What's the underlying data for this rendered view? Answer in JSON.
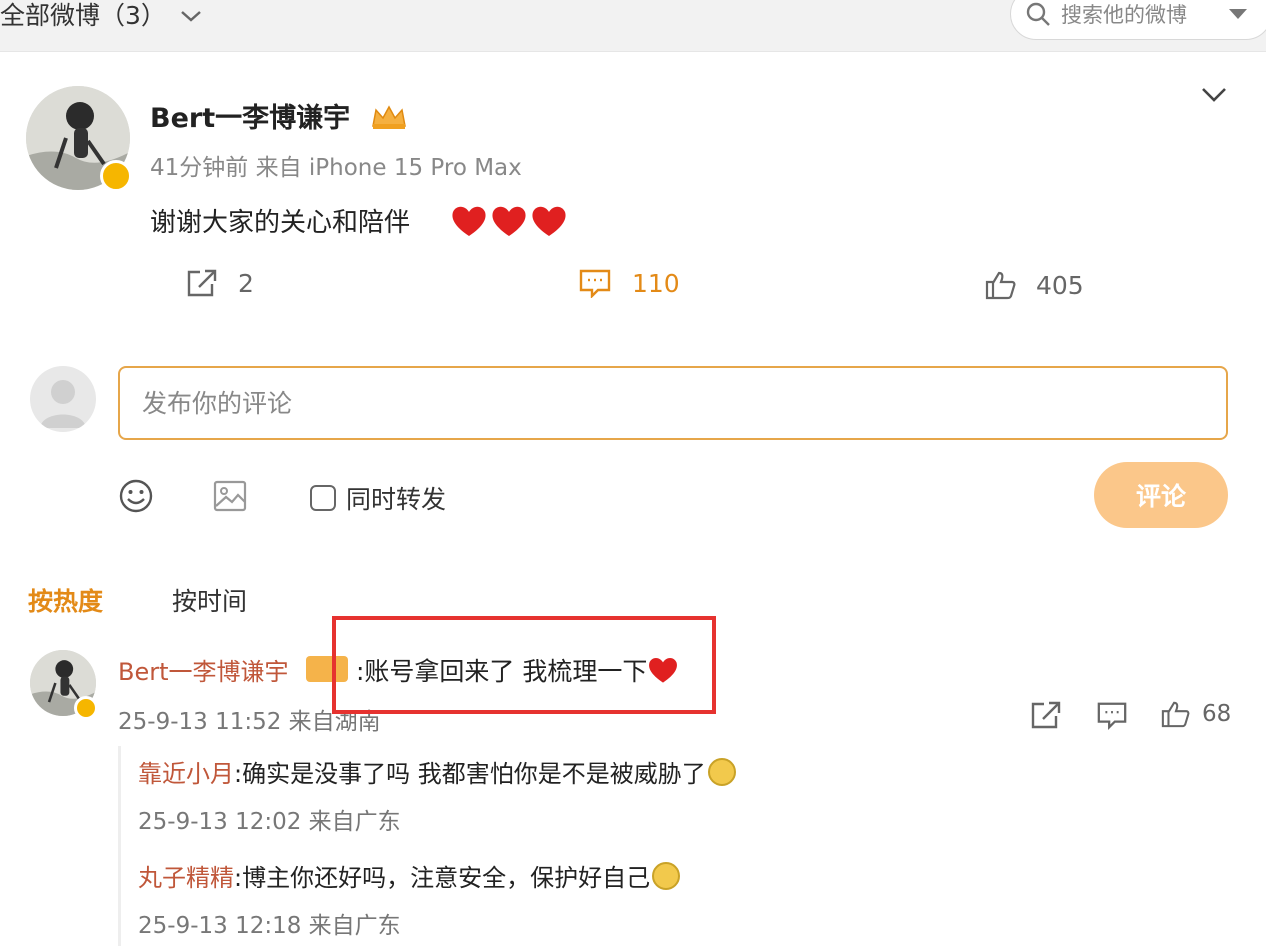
{
  "topbar": {
    "filter_label": "全部微博（3）",
    "search_placeholder": "搜索他的微博"
  },
  "post": {
    "author": "Bert一李博谦宇",
    "meta": "41分钟前 来自 iPhone 15 Pro Max",
    "text": "谢谢大家的关心和陪伴",
    "repost_count": "2",
    "comment_count": "110",
    "like_count": "405"
  },
  "composer": {
    "placeholder": "发布你的评论",
    "repost_label": "同时转发",
    "submit_label": "评论"
  },
  "sort": {
    "hot_label": "按热度",
    "time_label": "按时间"
  },
  "comment": {
    "author": "Bert一李博谦宇",
    "text": ":账号拿回来了 我梳理一下",
    "meta": "25-9-13 11:52 来自湖南",
    "like_count": "68"
  },
  "replies": [
    {
      "author": "靠近小月",
      "text": ":确实是没事了吗 我都害怕你是不是被威胁了",
      "meta": "25-9-13 12:02 来自广东"
    },
    {
      "author": "丸子精精",
      "text": ":博主你还好吗，注意安全，保护好自己",
      "meta": "25-9-13 12:18 来自广东"
    }
  ],
  "colors": {
    "accent": "#e38a17",
    "username": "#c0573a",
    "highlight": "#e6322f",
    "heart": "#e02020",
    "verified": "#f6b600"
  }
}
